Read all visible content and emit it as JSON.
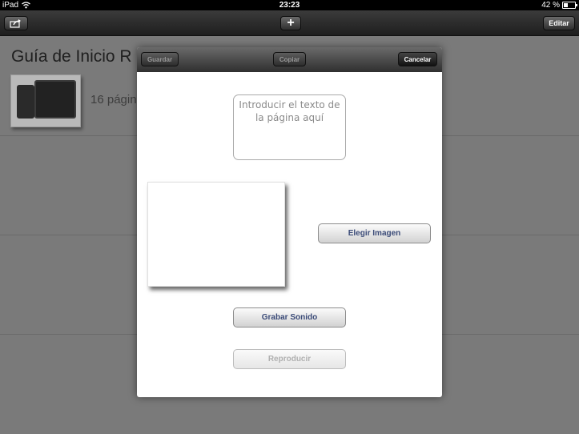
{
  "status_bar": {
    "device": "iPad",
    "time": "23:23",
    "battery": "42 %"
  },
  "toolbar": {
    "add_label": "+",
    "edit_label": "Editar"
  },
  "background": {
    "title": "Guía de Inicio R",
    "meta": "16 págin"
  },
  "modal": {
    "save_label": "Guardar",
    "copy_label": "Copiar",
    "cancel_label": "Cancelar",
    "text_placeholder": "Introducir el texto de la página aquí",
    "choose_image_label": "Elegir Imagen",
    "record_sound_label": "Grabar Sonido",
    "play_label": "Reproducir"
  }
}
